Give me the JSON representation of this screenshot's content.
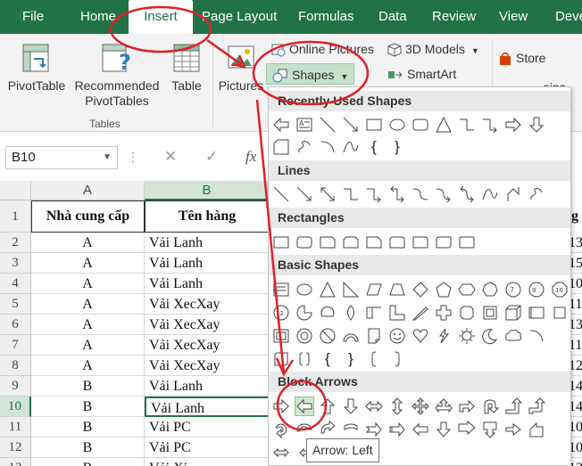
{
  "tabs": {
    "file": "File",
    "home": "Home",
    "insert": "Insert",
    "page_layout": "Page Layout",
    "formulas": "Formulas",
    "data": "Data",
    "review": "Review",
    "view": "View",
    "developer": "Deve"
  },
  "ribbon": {
    "pivot_table": "PivotTable",
    "recommended_line1": "Recommended",
    "recommended_line2": "PivotTables",
    "table": "Table",
    "tables_group": "Tables",
    "pictures": "Pictures",
    "online_pictures": "Online Pictures",
    "shapes": "Shapes",
    "models_3d": "3D Models",
    "smartart": "SmartArt",
    "store": "Store",
    "partial_addins": "eins"
  },
  "formula_bar": {
    "name_box": "B10",
    "cancel": "✕",
    "enter": "✓",
    "fx": "fx"
  },
  "grid": {
    "columns": [
      "A",
      "B"
    ],
    "selected_column": "B",
    "selected_row": "10",
    "header_row": {
      "row": "1",
      "a": "Nhà cung cấp",
      "b": "Tên hàng",
      "c_partial": "g"
    },
    "rows": [
      {
        "row": "2",
        "a": "A",
        "b": "Vải Lanh",
        "c_partial": "13"
      },
      {
        "row": "3",
        "a": "A",
        "b": "Vải Lanh",
        "c_partial": "15"
      },
      {
        "row": "4",
        "a": "A",
        "b": "Vải Lanh",
        "c_partial": "10"
      },
      {
        "row": "5",
        "a": "A",
        "b": "Vải XecXay",
        "c_partial": "11"
      },
      {
        "row": "6",
        "a": "A",
        "b": "Vải XecXay",
        "c_partial": "13"
      },
      {
        "row": "7",
        "a": "A",
        "b": "Vải XecXay",
        "c_partial": "11"
      },
      {
        "row": "8",
        "a": "A",
        "b": "Vải XecXay",
        "c_partial": "12"
      },
      {
        "row": "9",
        "a": "B",
        "b": "Vải Lanh",
        "c_partial": "14"
      },
      {
        "row": "10",
        "a": "B",
        "b": "Vải Lanh",
        "c_partial": "14"
      },
      {
        "row": "11",
        "a": "B",
        "b": "Vải PC",
        "c_partial": "10"
      },
      {
        "row": "12",
        "a": "B",
        "b": "Vải PC",
        "c_partial": "10"
      },
      {
        "row": "13",
        "a": "B",
        "b": "Vải Xi",
        "c_partial": "12"
      }
    ]
  },
  "shapes_menu": {
    "recently_used": "Recently Used Shapes",
    "lines": "Lines",
    "rectangles": "Rectangles",
    "basic_shapes": "Basic Shapes",
    "block_arrows": "Block Arrows",
    "brace_left": "{",
    "brace_right": "}",
    "tooltip": "Arrow: Left"
  },
  "colors": {
    "excel_green": "#217346",
    "annotation_red": "#e0202a"
  }
}
